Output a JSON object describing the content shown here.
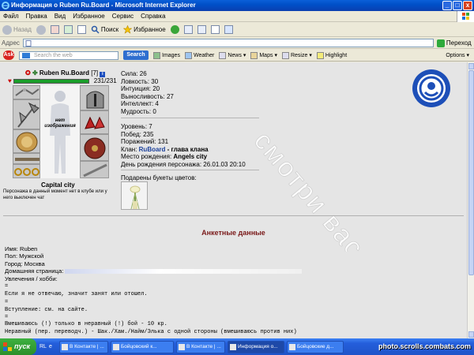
{
  "window": {
    "title": "Информация о Ruben Ru.Board - Microsoft Internet Explorer",
    "controls": [
      "_",
      "□",
      "x"
    ]
  },
  "menu": [
    "Файл",
    "Правка",
    "Вид",
    "Избранное",
    "Сервис",
    "Справка"
  ],
  "toolbar": {
    "back": "Назад",
    "search": "Поиск",
    "favorites": "Избранное"
  },
  "address": {
    "label": "Адрес",
    "value": "",
    "go": "Переход"
  },
  "askbar": {
    "logo": "Ask",
    "search_placeholder": "Search the web",
    "search_button": "Search",
    "items": [
      "Images",
      "Weather",
      "News",
      "Maps",
      "Resize",
      "Highlight"
    ],
    "options": "Options"
  },
  "character": {
    "name": "Ruben Ru.Board",
    "level_tag": "[7]",
    "info_badge": "i",
    "hp_text": "231/231",
    "hp_fraction": 1.0,
    "no_image_text": "нет изображения",
    "city": "Capital city",
    "status_note": "Персонажа в данный момент нет в клубе или у него выключен чат"
  },
  "stats": [
    "Сила: 26",
    "Ловкость: 30",
    "Интуиция: 20",
    "Выносливость: 27",
    "Интеллект: 4",
    "Мудрость: 0"
  ],
  "bio": {
    "level": "Уровень: 7",
    "wins": "Побед: 235",
    "losses": "Поражений: 131",
    "clan_label": "Клан:",
    "clan_name": "RuBoard",
    "clan_role": "- глава клана",
    "birthplace_label": "Место рождения:",
    "birthplace": "Angels city",
    "birthday": "День рождения персонажа: 26.01.03 20:10"
  },
  "gifts_label": "Подарены букеты цветов:",
  "watermark_text": "смотри вася",
  "section_title": "Анкетные данные",
  "profile": {
    "name": "Имя: Ruben",
    "sex": "Пол: Мужской",
    "city": "Город: Москва",
    "homepage": "Домашняя страница:",
    "hobbies": "Увлечения / хобби:"
  },
  "profile_text": [
    "=",
    "Если я не отвечаю, значит занят или отошел.",
    "=",
    "Вступление: см. на сайте.",
    "=",
    "Вмешиваюсь (!) только в неравный (!) бой - 10 кр.",
    "Неравный (пер. переводч.) - Шак./Хам./Найм/Элька с одной стороны (вмешиваюсь против них)"
  ],
  "taskbar": {
    "start": "пуск",
    "quicklaunch": "RL",
    "tasks": [
      "В Контакте | ...",
      "Бойцовский к...",
      "В Контакте | ...",
      "Информация о...",
      "Бойцовские д..."
    ]
  },
  "site_watermark": "photo.scrolls.combats.com"
}
